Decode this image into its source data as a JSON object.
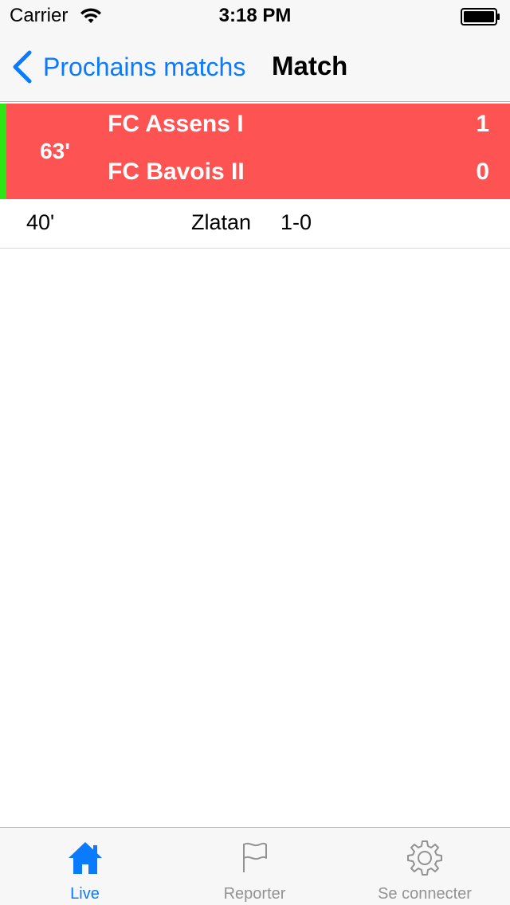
{
  "status_bar": {
    "carrier": "Carrier",
    "time": "3:18 PM"
  },
  "nav": {
    "back_label": "Prochains matchs",
    "title": "Match"
  },
  "match": {
    "minute": "63'",
    "home_team": "FC Assens I",
    "away_team": "FC Bavois II",
    "home_score": "1",
    "away_score": "0",
    "colors": {
      "header_background": "#fd5353",
      "live_indicator": "#2ee616"
    }
  },
  "events": [
    {
      "minute": "40'",
      "player": "Zlatan",
      "score": "1-0"
    }
  ],
  "tab_bar": {
    "items": [
      {
        "label": "Live",
        "icon": "home-icon",
        "active": true
      },
      {
        "label": "Reporter",
        "icon": "flag-icon",
        "active": false
      },
      {
        "label": "Se connecter",
        "icon": "gear-icon",
        "active": false
      }
    ],
    "colors": {
      "active": "#0a7aff",
      "inactive": "#929292"
    }
  }
}
